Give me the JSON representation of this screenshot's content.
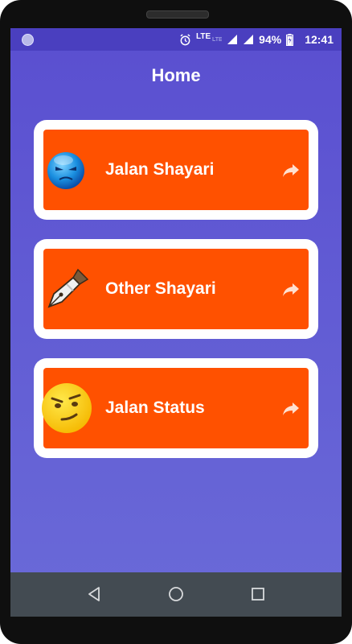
{
  "status_bar": {
    "network": "LTE",
    "battery": "94%",
    "time": "12:41"
  },
  "header": {
    "title": "Home"
  },
  "menu": [
    {
      "label": "Jalan Shayari",
      "icon": "angry-face-icon"
    },
    {
      "label": "Other Shayari",
      "icon": "pen-nib-icon"
    },
    {
      "label": "Jalan Status",
      "icon": "smirk-face-icon"
    }
  ],
  "colors": {
    "background_top": "#5a4fd0",
    "background_bottom": "#6a6ad8",
    "status_bar": "#4a3fbf",
    "card_fill": "#ff5100",
    "card_border": "#ffffff",
    "nav_bar": "#434b52"
  },
  "nav_bar": [
    "back-icon",
    "home-icon",
    "recents-icon"
  ]
}
